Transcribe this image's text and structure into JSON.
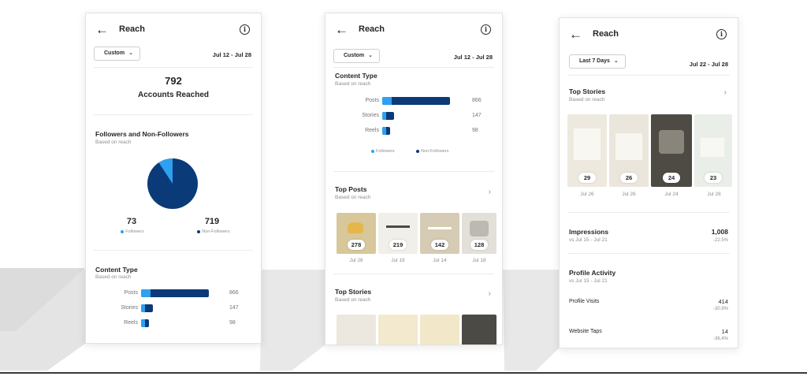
{
  "colors": {
    "followers": "#2fa0ef",
    "non_followers": "#0b3a78"
  },
  "screen1": {
    "title": "Reach",
    "dropdown": "Custom",
    "range": "Jul 12 - Jul 28",
    "accounts_reached": "792",
    "accounts_reached_label": "Accounts Reached",
    "followers_section": {
      "title": "Followers and Non-Followers",
      "subtitle": "Based on reach"
    },
    "followers": {
      "value": "73",
      "label": "Followers"
    },
    "non_followers": {
      "value": "719",
      "label": "Non-Followers"
    },
    "content_type": {
      "title": "Content Type",
      "subtitle": "Based on reach",
      "rows": [
        {
          "label": "Posts",
          "value": "866"
        },
        {
          "label": "Stories",
          "value": "147"
        },
        {
          "label": "Reels",
          "value": "98"
        }
      ]
    }
  },
  "screen2": {
    "title": "Reach",
    "dropdown": "Custom",
    "range": "Jul 12 - Jul 28",
    "content_type": {
      "title": "Content Type",
      "subtitle": "Based on reach",
      "rows": [
        {
          "label": "Posts",
          "value": "866"
        },
        {
          "label": "Stories",
          "value": "147"
        },
        {
          "label": "Reels",
          "value": "98"
        }
      ],
      "legend_followers": "Followers",
      "legend_non_followers": "Non-Followers"
    },
    "top_posts": {
      "title": "Top Posts",
      "subtitle": "Based on reach",
      "items": [
        {
          "value": "278",
          "date": "Jul 26"
        },
        {
          "value": "219",
          "date": "Jul 19"
        },
        {
          "value": "142",
          "date": "Jul 14"
        },
        {
          "value": "128",
          "date": "Jul 18"
        }
      ]
    },
    "top_stories": {
      "title": "Top Stories",
      "subtitle": "Based on reach"
    }
  },
  "screen3": {
    "title": "Reach",
    "dropdown": "Last 7 Days",
    "range": "Jul 22 - Jul 28",
    "top_stories": {
      "title": "Top Stories",
      "subtitle": "Based on reach",
      "items": [
        {
          "value": "29",
          "date": "Jul 26"
        },
        {
          "value": "26",
          "date": "Jul 26"
        },
        {
          "value": "24",
          "date": "Jul 24"
        },
        {
          "value": "23",
          "date": "Jul 28"
        }
      ]
    },
    "impressions": {
      "title": "Impressions",
      "compare": "vs Jul 15 - Jul 21",
      "value": "1,008",
      "change": "-22.5%"
    },
    "profile_activity": {
      "title": "Profile Activity",
      "compare": "vs Jul 15 - Jul 21",
      "profile_visits": {
        "label": "Profile Visits",
        "value": "414",
        "change": "-30.9%"
      },
      "website_taps": {
        "label": "Website Taps",
        "value": "14",
        "change": "-36.4%"
      }
    }
  }
}
